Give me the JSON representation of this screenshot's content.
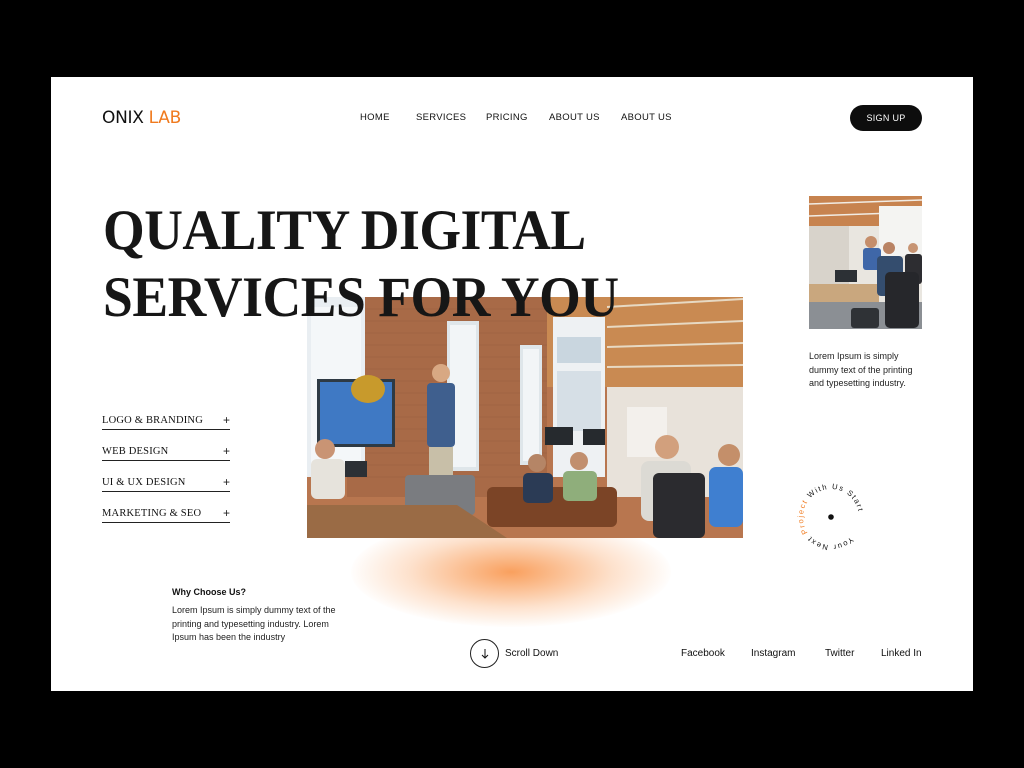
{
  "header": {
    "logo_main": "ONIX",
    "logo_accent": "LAB",
    "nav": [
      "HOME",
      "SERVICES",
      "PRICING",
      "ABOUT US",
      "ABOUT US"
    ],
    "signup_label": "SIGN UP"
  },
  "hero": {
    "title_line1": "QUALITY DIGITAL",
    "title_line2": "SERVICES FOR YOU"
  },
  "services": [
    {
      "label": "LOGO & BRANDING",
      "icon": "plus-icon"
    },
    {
      "label": "WEB DESIGN",
      "icon": "plus-icon"
    },
    {
      "label": "UI & UX DESIGN",
      "icon": "plus-icon"
    },
    {
      "label": "MARKETING & SEO",
      "icon": "plus-icon"
    }
  ],
  "side": {
    "text": "Lorem Ipsum is simply dummy text of the printing and typesetting industry."
  },
  "badge": {
    "text_dark1": "Your Next ",
    "text_accent": "Project",
    "text_dark2": " With Us Start"
  },
  "why": {
    "title": "Why Choose Us?",
    "text": "Lorem Ipsum is simply dummy text of the printing and typesetting industry. Lorem Ipsum has been the industry"
  },
  "scroll": {
    "label": "Scroll Down",
    "icon": "arrow-down-icon"
  },
  "social": [
    "Facebook",
    "Instagram",
    "Twitter",
    "Linked In"
  ],
  "colors": {
    "accent": "#f07a1e",
    "dark": "#0d0d0d",
    "background": "#000000",
    "card": "#ffffff"
  }
}
